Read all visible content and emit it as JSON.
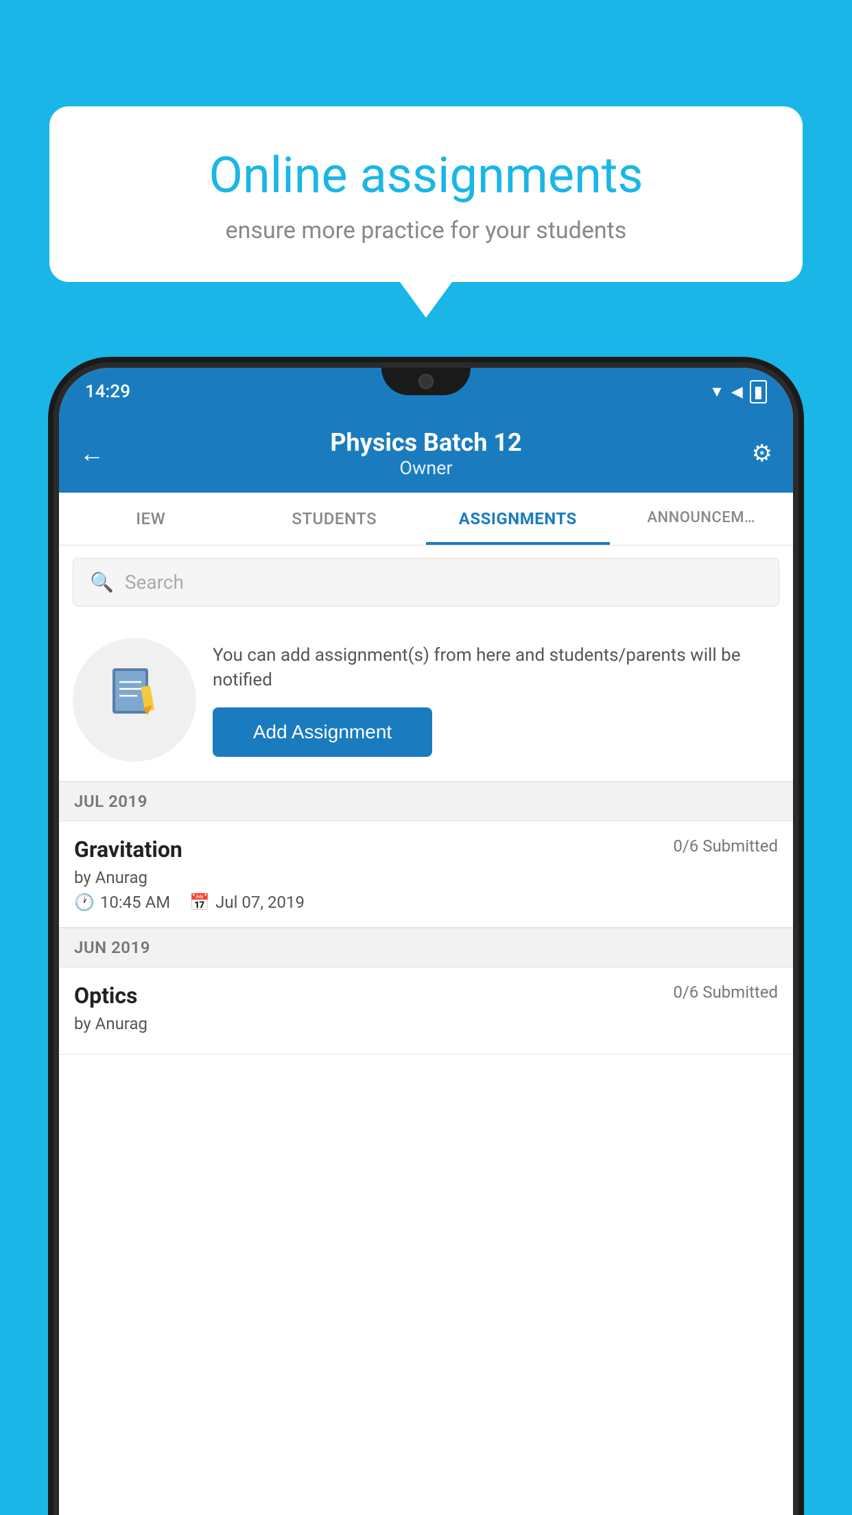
{
  "background_color": "#1ab6e8",
  "speech_bubble": {
    "title": "Online assignments",
    "subtitle": "ensure more practice for your students"
  },
  "phone": {
    "status_bar": {
      "time": "14:29",
      "wifi_icon": "wifi",
      "signal_icon": "signal",
      "battery_icon": "battery"
    },
    "header": {
      "title": "Physics Batch 12",
      "subtitle": "Owner",
      "back_label": "←",
      "gear_label": "⚙"
    },
    "tabs": [
      {
        "label": "IEW",
        "active": false
      },
      {
        "label": "STUDENTS",
        "active": false
      },
      {
        "label": "ASSIGNMENTS",
        "active": true
      },
      {
        "label": "ANNOUNCEM…",
        "active": false
      }
    ],
    "search": {
      "placeholder": "Search"
    },
    "add_assignment": {
      "description": "You can add assignment(s) from here and students/parents will be notified",
      "button_label": "Add Assignment"
    },
    "sections": [
      {
        "label": "JUL 2019",
        "items": [
          {
            "name": "Gravitation",
            "submitted": "0/6 Submitted",
            "by": "by Anurag",
            "time": "10:45 AM",
            "date": "Jul 07, 2019"
          }
        ]
      },
      {
        "label": "JUN 2019",
        "items": [
          {
            "name": "Optics",
            "submitted": "0/6 Submitted",
            "by": "by Anurag",
            "time": "",
            "date": ""
          }
        ]
      }
    ]
  }
}
